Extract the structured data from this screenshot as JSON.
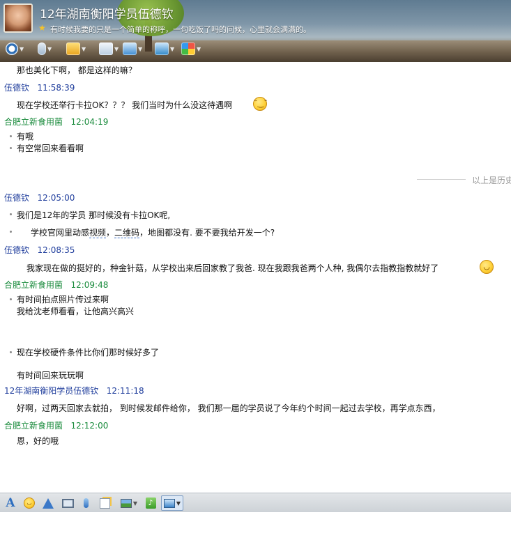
{
  "header": {
    "contact_name": "12年湖南衡阳学员伍德钦",
    "signature": "有时候我要的只是一个简单的称呼，一句吃饭了吗的问候，心里就会满满的。",
    "toolbar_icons": [
      "video-call-icon",
      "voice-call-icon",
      "send-file-icon",
      "create-group-icon",
      "remote-desktop-icon",
      "share-screen-icon",
      "apps-icon"
    ]
  },
  "messages": {
    "line_top": "那也美化下啊， 都是这样的嘛？",
    "m1": {
      "sender": "伍德钦",
      "time": "11:58:39",
      "text": "现在学校还举行卡拉OK？？？  我们当时为什么没这待遇啊"
    },
    "m2": {
      "sender": "合肥立新食用菌",
      "time": "12:04:19",
      "lines": [
        "有哦",
        "有空常回来看看啊"
      ]
    },
    "history_label": "以上是历史",
    "m3": {
      "sender": "伍德钦",
      "time": "12:05:00",
      "line1": "我们是12年的学员   那时候没有卡拉OK呢,",
      "line2_a": "学校官网里动感",
      "line2_b": "视频",
      "line2_c": "，",
      "line2_d": "二维码",
      "line2_e": "，地图都没有.   要不要我给开发一个?"
    },
    "m4": {
      "sender": "伍德钦",
      "time": "12:08:35",
      "text": "我家现在做的挺好的，种金针菇，从学校出来后回家教了我爸. 现在我跟我爸两个人种, 我偶尔去指教指教就好了"
    },
    "m5": {
      "sender": "合肥立新食用菌",
      "time": "12:09:48",
      "lines": [
        "有时间拍点照片传过来啊",
        "我给沈老师看看，让他高兴高兴"
      ],
      "line3": "现在学校硬件条件比你们那时候好多了",
      "line4": "有时间回来玩玩啊"
    },
    "m6": {
      "sender": "12年湖南衡阳学员伍德钦",
      "time": "12:11:18",
      "text": "好啊，过两天回家去就拍， 到时候发邮件给你，  我们那一届的学员说了今年约个时间一起过去学校，再学点东西，"
    },
    "m7": {
      "sender": "合肥立新食用菌",
      "time": "12:12:00",
      "text": "恩，好的哦"
    }
  },
  "input_toolbar": {
    "icons": [
      "font-icon",
      "emoticon-icon",
      "shake-icon",
      "gif-icon",
      "voice-message-icon",
      "rich-text-icon",
      "picture-icon",
      "music-icon",
      "screenshot-icon"
    ]
  },
  "colors": {
    "sender_blue": "#1f3d9c",
    "sender_green": "#178a3a"
  }
}
